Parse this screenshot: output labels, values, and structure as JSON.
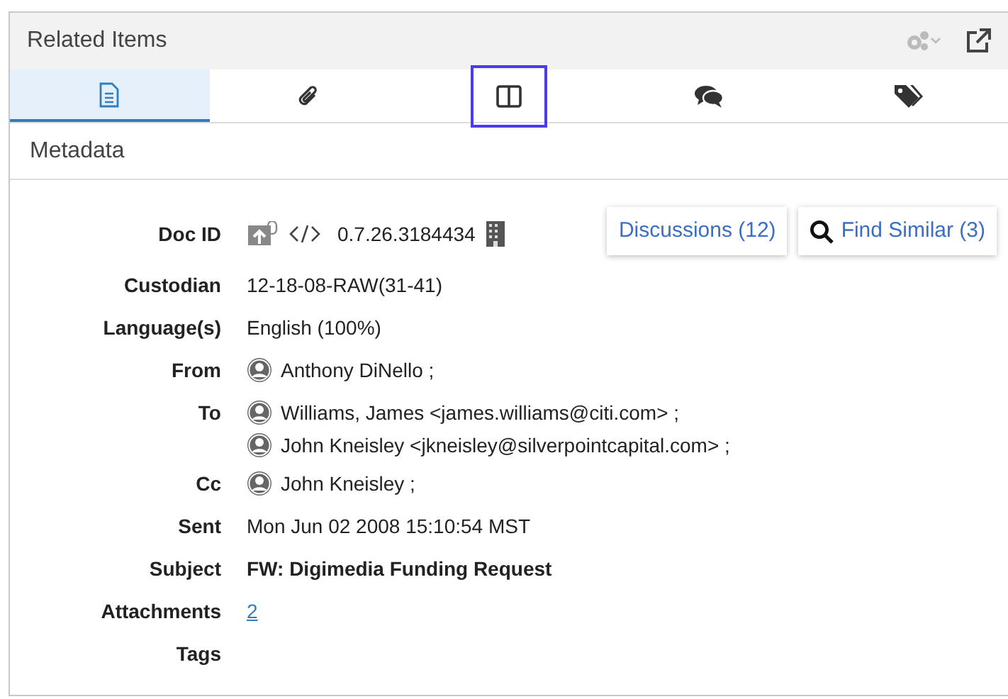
{
  "panel": {
    "title": "Related Items"
  },
  "tabs": [
    {
      "kind": "document",
      "selected": true,
      "focused": false
    },
    {
      "kind": "paperclip",
      "selected": false,
      "focused": false
    },
    {
      "kind": "columns",
      "selected": false,
      "focused": true
    },
    {
      "kind": "chat",
      "selected": false,
      "focused": false
    },
    {
      "kind": "tags",
      "selected": false,
      "focused": false
    }
  ],
  "section": {
    "title": "Metadata"
  },
  "actions": [
    {
      "kind": "plain",
      "label": "Discussions (12)"
    },
    {
      "kind": "search",
      "label": "Find Similar (3)"
    }
  ],
  "fields": [
    {
      "kind": "docid",
      "label": "Doc ID",
      "value": "0.7.26.3184434"
    },
    {
      "kind": "text",
      "label": "Custodian",
      "value": "12-18-08-RAW(31-41)"
    },
    {
      "kind": "text",
      "label": "Language(s)",
      "value": "English (100%)"
    },
    {
      "kind": "people",
      "label": "From",
      "people": [
        "Anthony DiNello ;"
      ]
    },
    {
      "kind": "people",
      "label": "To",
      "people": [
        "Williams, James <james.williams@citi.com> ;",
        "John Kneisley <jkneisley@silverpointcapital.com> ;"
      ]
    },
    {
      "kind": "people",
      "label": "Cc",
      "people": [
        "John Kneisley ;"
      ]
    },
    {
      "kind": "text",
      "label": "Sent",
      "value": "Mon Jun 02 2008 15:10:54 MST"
    },
    {
      "kind": "bold",
      "label": "Subject",
      "value": "FW: Digimedia Funding Request"
    },
    {
      "kind": "link",
      "label": "Attachments",
      "value": "2"
    },
    {
      "kind": "empty",
      "label": "Tags"
    }
  ]
}
